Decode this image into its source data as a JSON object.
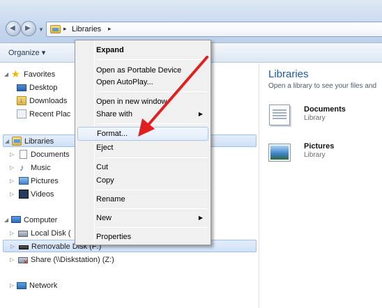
{
  "address_bar": {
    "path_item": "Libraries",
    "back_icon": "back-arrow-icon",
    "forward_icon": "forward-arrow-icon",
    "separator": "▸"
  },
  "toolbar": {
    "organize_label": "Organize ▾"
  },
  "nav": {
    "favorites": "Favorites",
    "desktop": "Desktop",
    "downloads": "Downloads",
    "recent": "Recent Plac",
    "libraries": "Libraries",
    "documents": "Documents",
    "music": "Music",
    "pictures": "Pictures",
    "videos": "Videos",
    "computer": "Computer",
    "local_disk": "Local Disk (",
    "removable": "Removable Disk (F:)",
    "share": "Share (\\\\Diskstation) (Z:)",
    "network": "Network"
  },
  "content": {
    "title": "Libraries",
    "subtitle": "Open a library to see your files and",
    "items": [
      {
        "name": "Documents",
        "type": "Library"
      },
      {
        "name": "Pictures",
        "type": "Library"
      }
    ]
  },
  "context_menu": {
    "items": [
      "Expand",
      "Open as Portable Device",
      "Open AutoPlay...",
      "Open in new window",
      "Share with",
      "Format...",
      "Eject",
      "Cut",
      "Copy",
      "Rename",
      "New",
      "Properties"
    ],
    "highlighted": "Format..."
  },
  "colors": {
    "annotation_arrow": "#e02020",
    "selection": "#cfe1f8",
    "title_blue": "#1e5aa0"
  }
}
